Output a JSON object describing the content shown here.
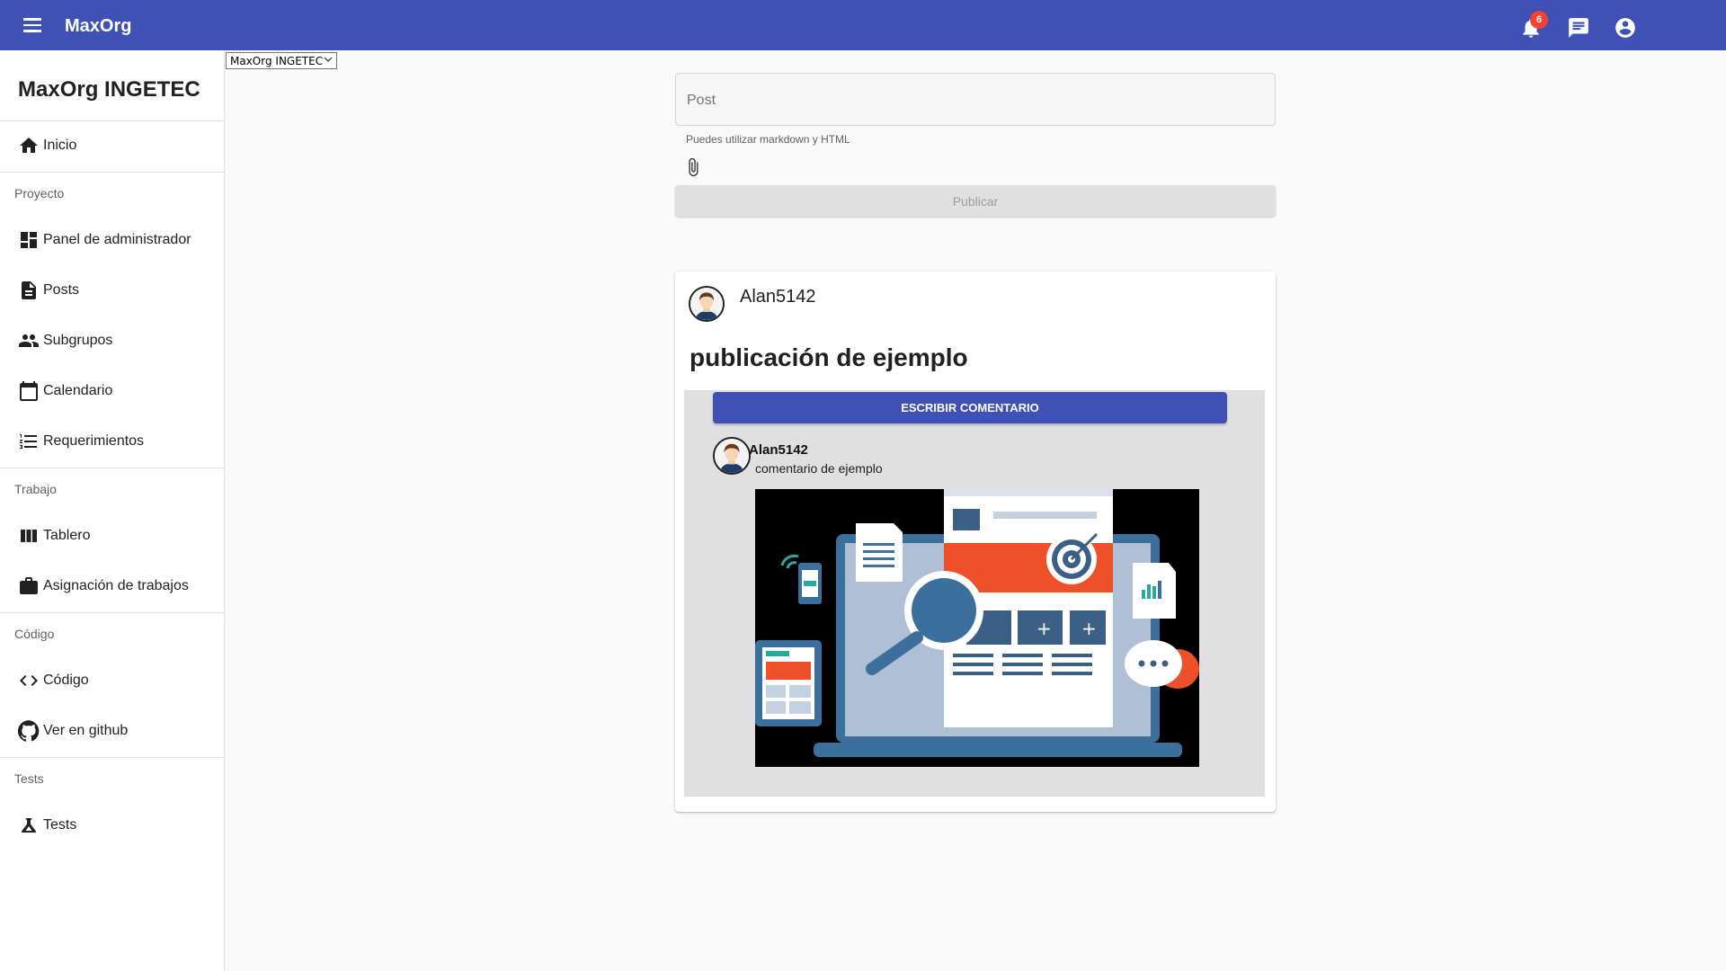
{
  "appbar": {
    "title": "MaxOrg",
    "notification_count": "6",
    "bar_color": "#3f51b5",
    "icons": [
      "menu-icon",
      "bell-icon",
      "chat-icon",
      "account-circle-icon"
    ]
  },
  "org_select": {
    "selected": "MaxOrg INGETEC"
  },
  "sidebar": {
    "org_name": "MaxOrg INGETEC",
    "home": {
      "label": "Inicio",
      "icon": "home-icon"
    },
    "sections": [
      {
        "label": "Proyecto",
        "items": [
          {
            "label": "Panel de administrador",
            "icon": "dashboard-icon"
          },
          {
            "label": "Posts",
            "icon": "document-icon"
          },
          {
            "label": "Subgrupos",
            "icon": "people-icon"
          },
          {
            "label": "Calendario",
            "icon": "calendar-icon"
          },
          {
            "label": "Requerimientos",
            "icon": "list-icon"
          }
        ]
      },
      {
        "label": "Trabajo",
        "items": [
          {
            "label": "Tablero",
            "icon": "board-icon"
          },
          {
            "label": "Asignación de trabajos",
            "icon": "briefcase-icon"
          }
        ]
      },
      {
        "label": "Código",
        "items": [
          {
            "label": "Código",
            "icon": "code-icon"
          },
          {
            "label": "Ver en github",
            "icon": "github-icon"
          }
        ]
      },
      {
        "label": "Tests",
        "items": [
          {
            "label": "Tests",
            "icon": "flask-icon"
          }
        ]
      }
    ]
  },
  "composer": {
    "placeholder": "Post",
    "helper": "Puedes utilizar markdown y HTML",
    "attach_icon": "paperclip-icon",
    "publish_label": "Publicar"
  },
  "post": {
    "author": "Alan5142",
    "title": "publicación de ejemplo",
    "comment_button": "ESCRIBIR COMENTARIO",
    "comments": [
      {
        "author": "Alan5142",
        "text": "comentario de ejemplo",
        "image": "web-analytics-illustration"
      }
    ]
  }
}
